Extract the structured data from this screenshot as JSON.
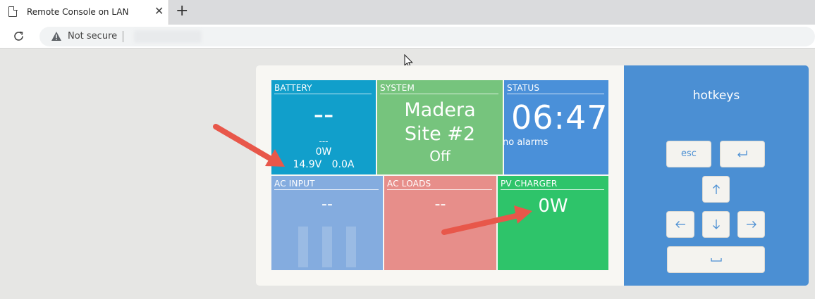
{
  "browser": {
    "tab_title": "Remote Console on LAN",
    "tab_close": "✕",
    "new_tab": "+",
    "security_label": "Not secure",
    "icons": [
      "page-icon",
      "close-icon",
      "plus-icon",
      "reload-icon",
      "warning-icon"
    ]
  },
  "console": {
    "battery": {
      "header": "BATTERY",
      "soc": "--",
      "state": "---",
      "power": "0W",
      "voltage": "14.9V",
      "current": "0.0A"
    },
    "system": {
      "header": "SYSTEM",
      "name_line1": "Madera",
      "name_line2": "Site #2",
      "state": "Off"
    },
    "status": {
      "header": "STATUS",
      "time": "06:47",
      "alarms": "no alarms"
    },
    "ac_input": {
      "header": "AC INPUT",
      "value": "--"
    },
    "ac_loads": {
      "header": "AC LOADS",
      "value": "--"
    },
    "pv_charger": {
      "header": "PV CHARGER",
      "value": "0W"
    },
    "colors": {
      "battery": "#119fcb",
      "system": "#76c47d",
      "status": "#4a90d9",
      "ac_input": "#84acdf",
      "ac_loads": "#e78e8a",
      "pv_charger": "#2ec46a"
    }
  },
  "hotkeys": {
    "title": "hotkeys",
    "esc_label": "esc",
    "icons": [
      "enter-icon",
      "arrow-up-icon",
      "arrow-left-icon",
      "arrow-down-icon",
      "arrow-right-icon",
      "space-icon"
    ]
  },
  "annotations": {
    "arrow_color": "#e8574a",
    "count": 2
  }
}
